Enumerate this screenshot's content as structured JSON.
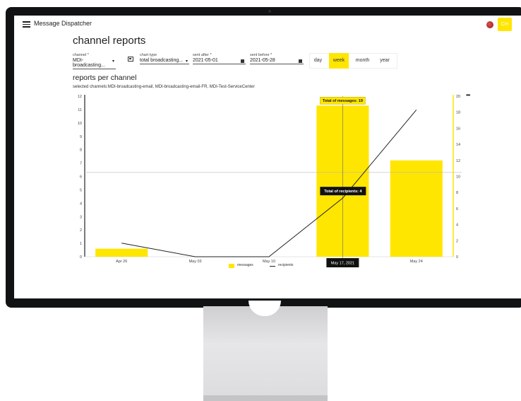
{
  "app": {
    "title": "Message Dispatcher",
    "avatar_initials": "CH"
  },
  "page": {
    "title": "channel reports",
    "sub_title": "reports per channel",
    "selected_channels": "selected channels:MDI-broadcasting-email, MDI-broadcasting-email-FR, MDI-Test-ServiceCenter"
  },
  "filters": {
    "channel": {
      "label": "channel *",
      "value": "MDI-broadcasting..."
    },
    "chart_type": {
      "label": "chart type",
      "value": "total broadcasting..."
    },
    "sent_after": {
      "label": "sent after *",
      "value": "2021-05-01"
    },
    "sent_before": {
      "label": "sent before *",
      "value": "2021-05-28"
    }
  },
  "periods": [
    {
      "label": "day",
      "active": false
    },
    {
      "label": "week",
      "active": true
    },
    {
      "label": "month",
      "active": false
    },
    {
      "label": "year",
      "active": false
    }
  ],
  "colors": {
    "accent": "#ffe600",
    "text": "#222222"
  },
  "icons": {
    "menu": "menu-icon",
    "flag": "flag-icon",
    "filter": "filter-icon",
    "more": "more-icon",
    "calendar": "calendar-icon"
  },
  "chart_data": {
    "type": "bar",
    "categories": [
      "Apr 26",
      "May 03",
      "May 10",
      "May 17",
      "May 24"
    ],
    "series": [
      {
        "name": "messages",
        "type": "bar",
        "axis": "left",
        "values": [
          0.6,
          0,
          0,
          11.3,
          7.2
        ]
      },
      {
        "name": "recipients",
        "type": "line",
        "axis": "right",
        "values": [
          1.7,
          0,
          0,
          7.3,
          18.3
        ]
      }
    ],
    "ylim_left": [
      0,
      12
    ],
    "ylim_right": [
      0,
      20
    ],
    "left_ticks": [
      0,
      1,
      2,
      3,
      4,
      5,
      6,
      7,
      8,
      9,
      10,
      11,
      12
    ],
    "right_ticks": [
      0,
      2,
      4,
      6,
      8,
      10,
      12,
      14,
      16,
      18,
      20
    ],
    "crosshair_value": 6.3,
    "hover": {
      "category": "May 17, 2021",
      "messages_label": "Total of messages: 19",
      "recipients_label": "Total of recipients: 4"
    },
    "legend": "bottom"
  }
}
